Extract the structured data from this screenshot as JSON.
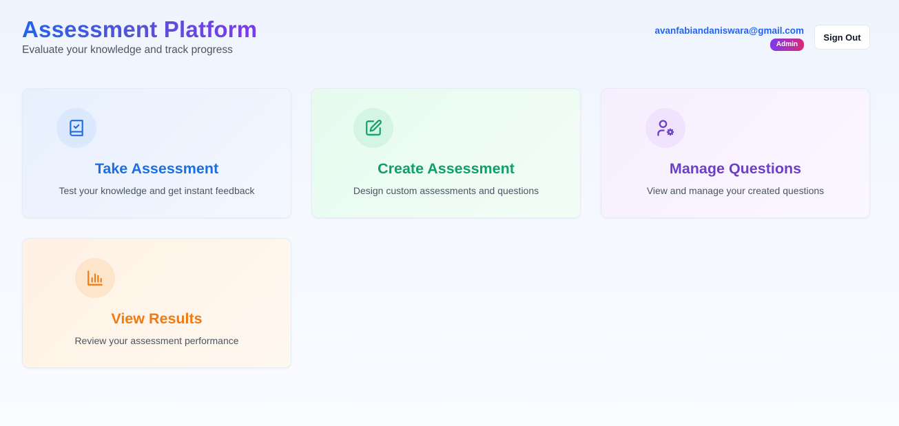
{
  "header": {
    "title": "Assessment Platform",
    "subtitle": "Evaluate your knowledge and track progress"
  },
  "user": {
    "email": "avanfabiandaniswara@gmail.com",
    "role": "Admin",
    "sign_out_label": "Sign Out"
  },
  "cards": [
    {
      "title": "Take Assessment",
      "description": "Test your knowledge and get instant feedback",
      "icon": "book-check-icon",
      "accent": "#1d6fe0"
    },
    {
      "title": "Create Assessment",
      "description": "Design custom assessments and questions",
      "icon": "edit-icon",
      "accent": "#0f9f6e"
    },
    {
      "title": "Manage Questions",
      "description": "View and manage your created questions",
      "icon": "user-cog-icon",
      "accent": "#6d3fc4"
    },
    {
      "title": "View Results",
      "description": "Review your assessment performance",
      "icon": "bar-chart-icon",
      "accent": "#f07a14"
    }
  ]
}
